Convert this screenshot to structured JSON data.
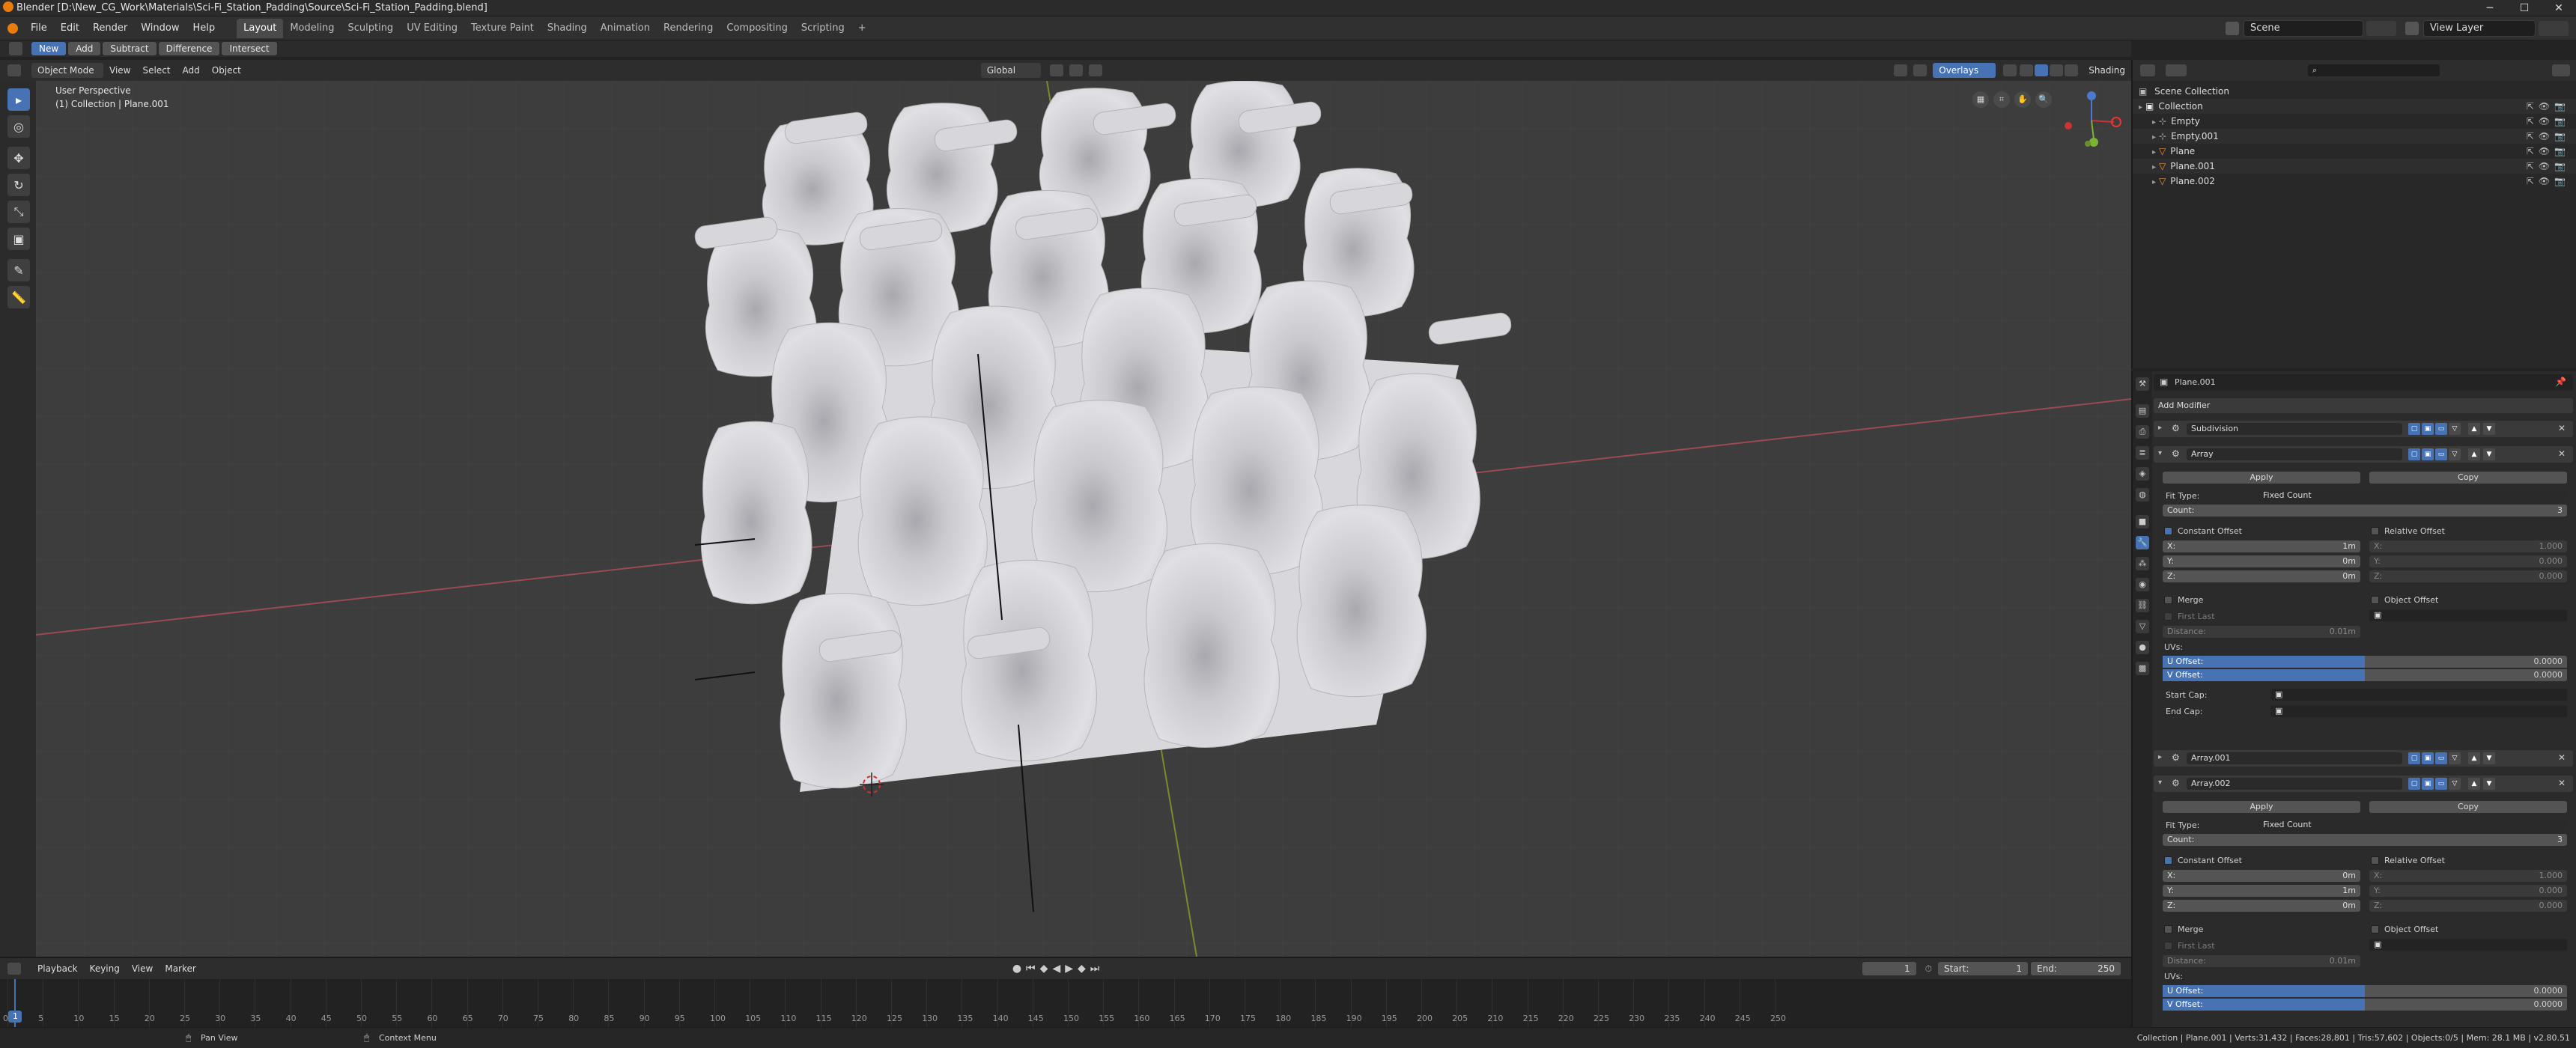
{
  "window": {
    "title": "Blender [D:\\New_CG_Work\\Materials\\Sci-Fi_Station_Padding\\Source\\Sci-Fi_Station_Padding.blend]",
    "controls": [
      "─",
      "☐",
      "✕"
    ]
  },
  "menu": {
    "items": [
      "File",
      "Edit",
      "Render",
      "Window",
      "Help"
    ],
    "workspaces": [
      "Layout",
      "Modeling",
      "Sculpting",
      "UV Editing",
      "Texture Paint",
      "Shading",
      "Animation",
      "Rendering",
      "Compositing",
      "Scripting"
    ],
    "active_workspace": "Layout",
    "add_tab": "+",
    "scene": "Scene",
    "view_layer": "View Layer"
  },
  "tool_header": {
    "buttons": [
      "New",
      "Add",
      "Subtract",
      "Difference",
      "Intersect"
    ],
    "active": "New"
  },
  "viewport_header": {
    "mode": "Object Mode",
    "menus": [
      "View",
      "Select",
      "Add",
      "Object"
    ],
    "orientation": "Global",
    "overlays": "Overlays",
    "shading": "Shading"
  },
  "viewport": {
    "view_name": "User Perspective",
    "collection_info": "(1) Collection | Plane.001",
    "gizmo_axes": [
      "X",
      "Y",
      "Z"
    ]
  },
  "outliner": {
    "search_placeholder": "",
    "root": "Scene Collection",
    "items": [
      {
        "name": "Collection",
        "level": 1,
        "icon": "collection-icon"
      },
      {
        "name": "Empty",
        "level": 2,
        "icon": "empty-icon"
      },
      {
        "name": "Empty.001",
        "level": 2,
        "icon": "empty-icon"
      },
      {
        "name": "Plane",
        "level": 2,
        "icon": "mesh-icon"
      },
      {
        "name": "Plane.001",
        "level": 2,
        "icon": "mesh-icon"
      },
      {
        "name": "Plane.002",
        "level": 2,
        "icon": "mesh-icon"
      }
    ]
  },
  "properties": {
    "object_name": "Plane.001",
    "add_modifier": "Add Modifier",
    "modifiers": [
      {
        "name": "Subdivision",
        "collapsed": true
      },
      {
        "name": "Array",
        "collapsed": false
      },
      {
        "name": "Array.001",
        "collapsed": true
      },
      {
        "name": "Array.002",
        "collapsed": false
      }
    ],
    "array1": {
      "apply": "Apply",
      "copy": "Copy",
      "fit_type_label": "Fit Type:",
      "fit_type": "Fixed Count",
      "count_label": "Count:",
      "count": "3",
      "constant_offset": "Constant Offset",
      "relative_offset": "Relative Offset",
      "x_label": "X:",
      "x": "1m",
      "y_label": "Y:",
      "y": "0m",
      "z_label": "Z:",
      "z": "0m",
      "rx": "1.000",
      "ry": "0.000",
      "rz": "0.000",
      "merge": "Merge",
      "first_last": "First Last",
      "distance_label": "Distance:",
      "distance": "0.01m",
      "object_offset": "Object Offset",
      "uvs": "UVs:",
      "u_offset_label": "U Offset:",
      "u_offset": "0.0000",
      "v_offset_label": "V Offset:",
      "v_offset": "0.0000",
      "start_cap": "Start Cap:",
      "end_cap": "End Cap:"
    },
    "array3": {
      "apply": "Apply",
      "copy": "Copy",
      "fit_type_label": "Fit Type:",
      "fit_type": "Fixed Count",
      "count_label": "Count:",
      "count": "3",
      "constant_offset": "Constant Offset",
      "relative_offset": "Relative Offset",
      "x_label": "X:",
      "x": "0m",
      "y_label": "Y:",
      "y": "1m",
      "z_label": "Z:",
      "z": "0m",
      "rx": "1.000",
      "ry": "0.000",
      "rz": "0.000",
      "merge": "Merge",
      "first_last": "First Last",
      "distance_label": "Distance:",
      "distance": "0.01m",
      "object_offset": "Object Offset",
      "uvs": "UVs:",
      "u_offset_label": "U Offset:",
      "u_offset": "0.0000",
      "v_offset_label": "V Offset:",
      "v_offset": "0.0000"
    }
  },
  "timeline": {
    "menus": [
      "Playback",
      "Keying",
      "View",
      "Marker"
    ],
    "current_frame": "1",
    "start_label": "Start:",
    "start": "1",
    "end_label": "End:",
    "end": "250",
    "ticks": [
      "0",
      "5",
      "10",
      "15",
      "20",
      "25",
      "30",
      "35",
      "40",
      "45",
      "50",
      "55",
      "60",
      "65",
      "70",
      "75",
      "80",
      "85",
      "90",
      "95",
      "100",
      "105",
      "110",
      "115",
      "120",
      "125",
      "130",
      "135",
      "140",
      "145",
      "150",
      "155",
      "160",
      "165",
      "170",
      "175",
      "180",
      "185",
      "190",
      "195",
      "200",
      "205",
      "210",
      "215",
      "220",
      "225",
      "230",
      "235",
      "240",
      "245",
      "250"
    ],
    "frame_marker": "1"
  },
  "statusbar": {
    "pan_view": "Pan View",
    "context_menu": "Context Menu",
    "stats": "Collection | Plane.001 | Verts:31,432 | Faces:28,801 | Tris:57,602 | Objects:0/5 | Mem: 28.1 MB | v2.80.51"
  }
}
